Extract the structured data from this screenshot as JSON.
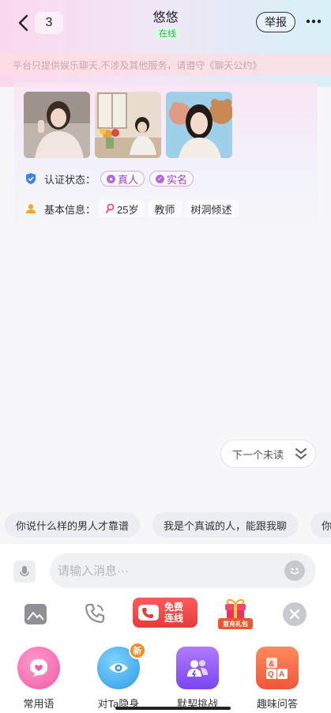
{
  "header": {
    "back_icon": "chevron-left-icon",
    "unread_count": "3",
    "title": "悠悠",
    "status": "在线",
    "report_label": "举报",
    "more_icon": "more-dots-icon"
  },
  "notice": "平台只提供娱乐聊天,不涉及其他服务，请遵守《聊天公约》",
  "profile": {
    "photos": [
      "photo-1",
      "photo-2",
      "photo-3"
    ],
    "auth_label": "认证状态：",
    "auth_tags": [
      "真人",
      "实名"
    ],
    "info_label": "基本信息：",
    "info_tags": [
      "25岁",
      "教师",
      "树洞倾述"
    ]
  },
  "next_unread": "下一个未读",
  "quick_replies": [
    "你说什么样的男人才靠谱",
    "我是个真诚的人，能跟我聊",
    "你"
  ],
  "input": {
    "placeholder": "请输入消息···"
  },
  "tools": {
    "free_call_line1": "免费",
    "free_call_line2": "连线",
    "gift_label": "首充礼包"
  },
  "features": [
    {
      "label": "常用语",
      "icon": "heart-chat-icon"
    },
    {
      "label": "对Ta隐身",
      "icon": "eye-icon",
      "badge": "新"
    },
    {
      "label": "默契挑战",
      "icon": "users-challenge-icon"
    },
    {
      "label": "趣味问答",
      "icon": "qa-cards-icon"
    }
  ],
  "colors": {
    "accent_purple": "#a43ec8",
    "online_green": "#27b45a",
    "call_red": "#e83b3b"
  }
}
